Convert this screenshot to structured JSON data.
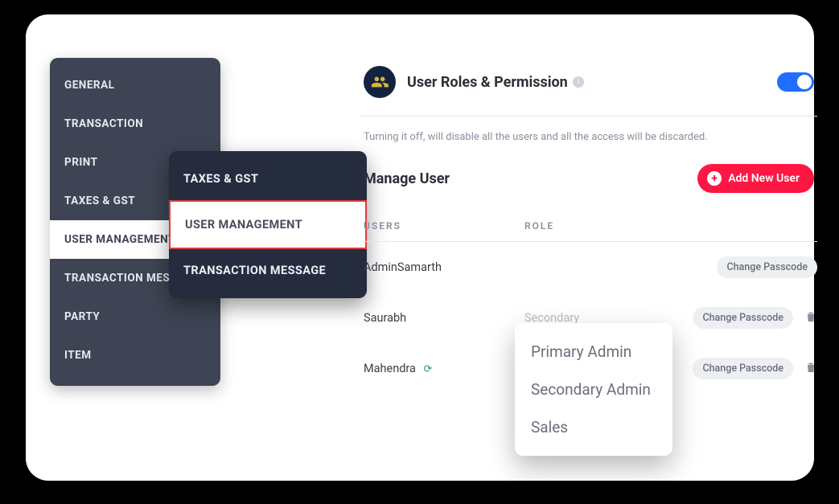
{
  "sidebar": {
    "items": [
      {
        "label": "GENERAL"
      },
      {
        "label": "TRANSACTION"
      },
      {
        "label": "PRINT"
      },
      {
        "label": "TAXES & GST"
      },
      {
        "label": "USER MANAGEMENT"
      },
      {
        "label": "TRANSACTION MESSAGE"
      },
      {
        "label": "PARTY"
      },
      {
        "label": "ITEM"
      }
    ],
    "active_index": 4
  },
  "float_menu": {
    "items": [
      {
        "label": "TAXES & GST"
      },
      {
        "label": "USER MANAGEMENT"
      },
      {
        "label": "TRANSACTION MESSAGE"
      }
    ],
    "active_index": 1
  },
  "header": {
    "title": "User Roles & Permission",
    "subtext": "Turning it off, will disable all the users and all the access will be discarded.",
    "toggle_on": true
  },
  "manage": {
    "title": "Manage User",
    "add_label": "Add New User",
    "columns": {
      "users": "USERS",
      "role": "ROLE"
    },
    "rows": [
      {
        "user": "AdminSamarth",
        "role": "",
        "action": "Change Passcode",
        "deletable": false,
        "syncing": false
      },
      {
        "user": "Saurabh",
        "role": "Secondary",
        "action": "Change Passcode",
        "deletable": true,
        "syncing": false
      },
      {
        "user": "Mahendra",
        "role": "",
        "action": "Change Passcode",
        "deletable": true,
        "syncing": true
      }
    ]
  },
  "role_dropdown": {
    "options": [
      {
        "label": "Primary Admin"
      },
      {
        "label": "Secondary Admin"
      },
      {
        "label": "Sales"
      }
    ]
  }
}
